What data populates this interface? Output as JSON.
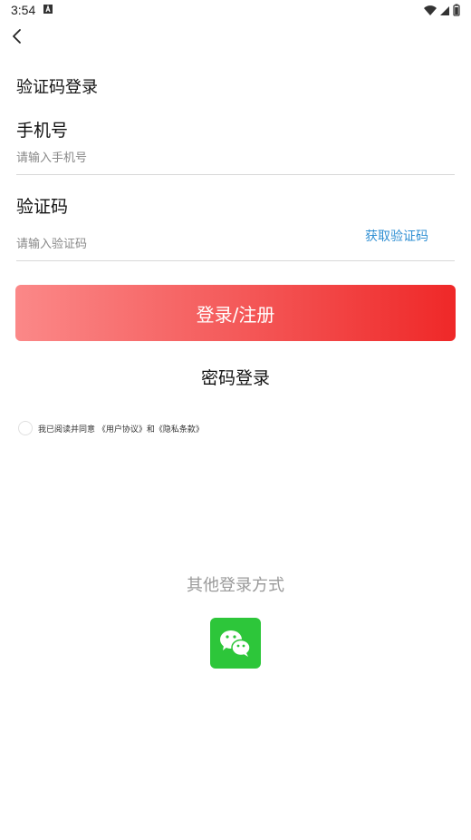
{
  "status_bar": {
    "time": "3:54",
    "icons": [
      "a-notification-icon",
      "wifi-icon",
      "signal-icon",
      "battery-icon"
    ]
  },
  "header": {
    "back_icon": "chevron-left-icon"
  },
  "page": {
    "title": "验证码登录"
  },
  "phone": {
    "label": "手机号",
    "placeholder": "请输入手机号",
    "value": ""
  },
  "code": {
    "label": "验证码",
    "placeholder": "请输入验证码",
    "value": "",
    "get_code_label": "获取验证码"
  },
  "login_button": {
    "label": "登录/注册"
  },
  "password_login": {
    "label": "密码登录"
  },
  "agreement": {
    "prefix": "我已阅读并同意",
    "user_agreement": "《用户协议》",
    "and": "和",
    "privacy_policy": "《隐私条款》",
    "checked": false
  },
  "other_login": {
    "title": "其他登录方式",
    "options": [
      "wechat-icon"
    ]
  },
  "colors": {
    "accent_red": "#ef2828",
    "link_blue": "#2f8fd3",
    "wechat_green": "#2dc63a"
  }
}
